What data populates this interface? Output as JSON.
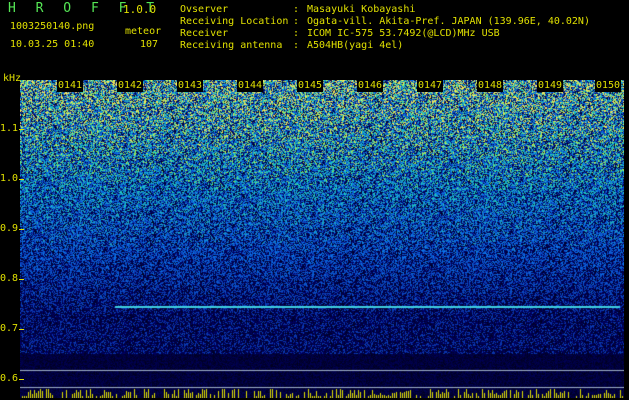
{
  "header": {
    "app_title": "H R O F F T",
    "app_version": "1.0.0",
    "file_name": "1003250140.png",
    "datetime": "10.03.25 01:40",
    "meteor_label": "meteor",
    "meteor_count": "107",
    "info": [
      {
        "key": "Ovserver",
        "value": "Masayuki Kobayashi"
      },
      {
        "key": "Receiving Location",
        "value": "Ogata-vill. Akita-Pref. JAPAN (139.96E, 40.02N)"
      },
      {
        "key": "Receiver",
        "value": "ICOM IC-575 53.7492(@LCD)MHz USB"
      },
      {
        "key": "Receiving antenna",
        "value": "A504HB(yagi 4el)"
      }
    ],
    "colon": ":"
  },
  "spectrogram": {
    "y_unit": "kHz",
    "y_ticks": [
      "1.1",
      "1.0",
      "0.9",
      "0.8",
      "0.7",
      "0.6"
    ],
    "x_ticks": [
      "0141",
      "0142",
      "0143",
      "0144",
      "0145",
      "0146",
      "0147",
      "0148",
      "0149",
      "0150"
    ],
    "colors": {
      "low": "#000033",
      "mid": "#1f4fd6",
      "high": "#2fd6a0",
      "peak": "#e0e000",
      "trace": "#40d0e0"
    }
  }
}
